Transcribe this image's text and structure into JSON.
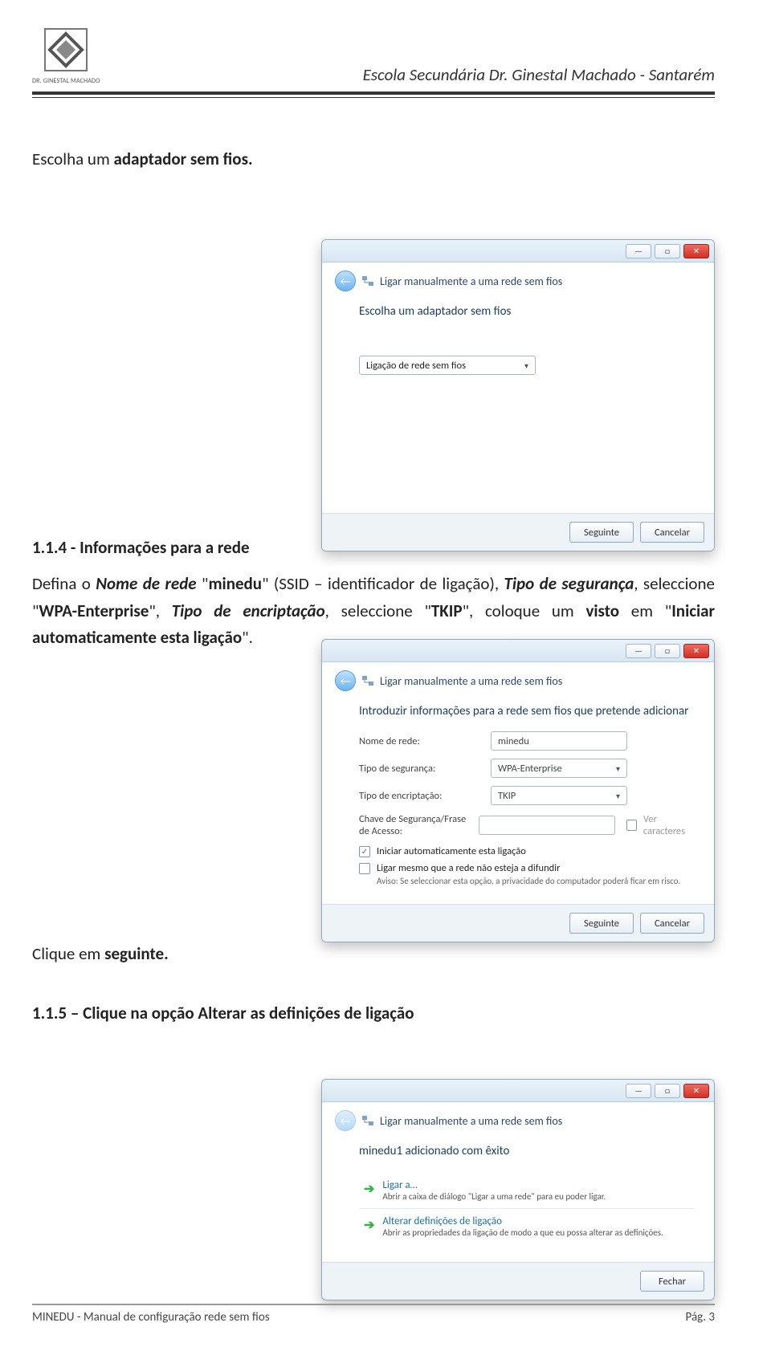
{
  "header": {
    "logo_caption": "DR. GINESTAL MACHADO",
    "school": "Escola Secundária Dr. Ginestal Machado - Santarém"
  },
  "text": {
    "p1_pre": "Escolha um ",
    "p1_bold": "adaptador sem fios.",
    "h114": "1.1.4 - Informações para a rede",
    "p2_a": "Defina o ",
    "p2_b": "Nome de rede",
    "p2_c": " \"",
    "p2_d": "minedu",
    "p2_e": "\" (SSID – identificador de ligação), ",
    "p2_f": "Tipo de segurança",
    "p2_g": ", seleccione \"",
    "p2_h": "WPA-Enterprise",
    "p2_i": "\", ",
    "p2_j": "Tipo de encriptação",
    "p2_k": ", seleccione \"",
    "p2_l": "TKIP",
    "p2_m": "\", coloque um ",
    "p2_n": "visto",
    "p2_o": " em \"",
    "p2_p": "Iniciar automaticamente esta ligação",
    "p2_q": "\".",
    "p3_a": "Clique em ",
    "p3_b": "seguinte.",
    "h115_a": "1.1.5 – Clique na opção ",
    "h115_b": "Alterar as definições de ligação"
  },
  "win_common": {
    "nav_title": "Ligar manualmente a uma rede sem fios",
    "btn_next": "Seguinte",
    "btn_cancel": "Cancelar",
    "btn_close": "Fechar",
    "min": "—",
    "max": "□",
    "close": "✕",
    "back": "←"
  },
  "win1": {
    "heading": "Escolha um adaptador sem fios",
    "combo": "Ligação de rede sem fios"
  },
  "win2": {
    "heading": "Introduzir informações para a rede sem fios que pretende adicionar",
    "lbl_name": "Nome de rede:",
    "val_name": "minedu",
    "lbl_sec": "Tipo de segurança:",
    "val_sec": "WPA-Enterprise",
    "lbl_enc": "Tipo de encriptação:",
    "val_enc": "TKIP",
    "lbl_key": "Chave de Segurança/Frase de Acesso:",
    "chk_show": "Ver caracteres",
    "chk_auto": "Iniciar automaticamente esta ligação",
    "chk_hidden": "Ligar mesmo que a rede não esteja a difundir",
    "hint": "Aviso: Se seleccionar esta opção, a privacidade do computador poderá ficar em risco."
  },
  "win3": {
    "heading": "minedu1 adicionado com êxito",
    "item1_title": "Ligar a…",
    "item1_desc": "Abrir a caixa de diálogo \"Ligar a uma rede\" para eu poder ligar.",
    "item2_title": "Alterar definições de ligação",
    "item2_desc": "Abrir as propriedades da ligação de modo a que eu possa alterar as definições."
  },
  "footer": {
    "left": "MINEDU - Manual de configuração rede sem fios",
    "right": "Pág. 3"
  }
}
